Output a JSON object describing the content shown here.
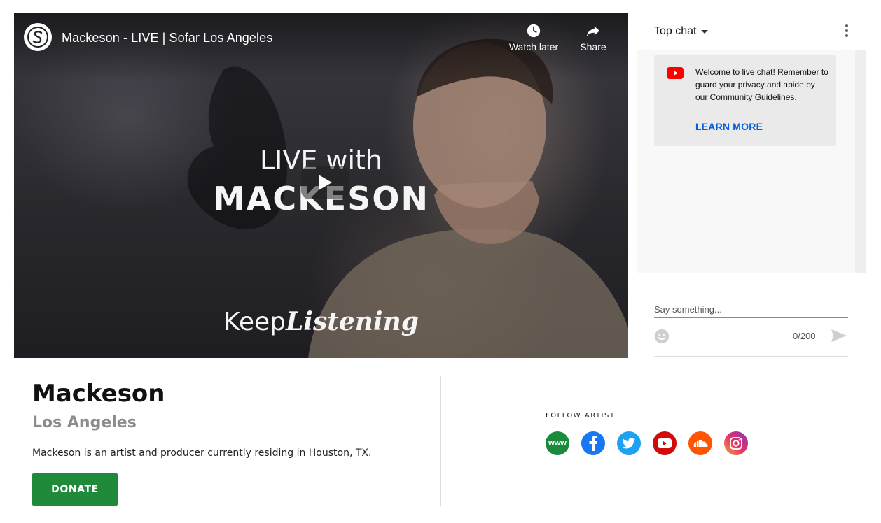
{
  "video": {
    "title": "Mackeson - LIVE | Sofar Los Angeles",
    "watch_later_label": "Watch later",
    "share_label": "Share",
    "overlay": {
      "line1": "LIVE with",
      "line2": "MACKESON",
      "keep": "Keep",
      "listening": "Listening"
    }
  },
  "chat": {
    "header_label": "Top chat",
    "welcome_message": "Welcome to live chat! Remember to guard your privacy and abide by our Community Guidelines.",
    "learn_more_label": "LEARN MORE",
    "input_placeholder": "Say something...",
    "char_count": "0/200"
  },
  "artist": {
    "name": "Mackeson",
    "city": "Los Angeles",
    "bio": "Mackeson is an artist and producer currently residing in Houston, TX.",
    "donate_label": "DONATE"
  },
  "follow": {
    "label": "FOLLOW ARTIST",
    "www_label": "www",
    "icons": [
      "website-icon",
      "facebook-icon",
      "twitter-icon",
      "youtube-icon",
      "soundcloud-icon",
      "instagram-icon"
    ]
  },
  "colors": {
    "donate": "#1e8a3a",
    "link": "#065fd4",
    "www": "#1a8a3c",
    "facebook": "#1877f2",
    "twitter": "#1da1f2",
    "youtube": "#d10a0a",
    "soundcloud": "#ff5500",
    "instagram": "#c13584"
  }
}
